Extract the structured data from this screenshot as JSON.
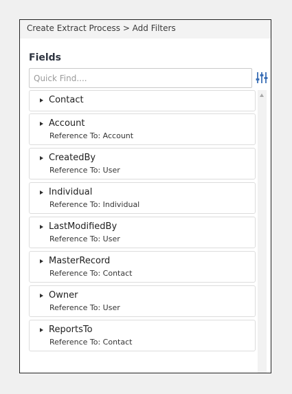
{
  "breadcrumb": "Create Extract Process > Add Filters",
  "section_title": "Fields",
  "search": {
    "placeholder": "Quick Find....",
    "value": ""
  },
  "filter_button": {
    "icon": "sliders-icon",
    "color": "#3b6fb6"
  },
  "fields": [
    {
      "name": "Contact",
      "ref": ""
    },
    {
      "name": "Account",
      "ref": "Reference To: Account"
    },
    {
      "name": "CreatedBy",
      "ref": "Reference To: User"
    },
    {
      "name": "Individual",
      "ref": "Reference To: Individual"
    },
    {
      "name": "LastModifiedBy",
      "ref": "Reference To: User"
    },
    {
      "name": "MasterRecord",
      "ref": "Reference To: Contact"
    },
    {
      "name": "Owner",
      "ref": "Reference To: User"
    },
    {
      "name": "ReportsTo",
      "ref": "Reference To: Contact"
    }
  ]
}
